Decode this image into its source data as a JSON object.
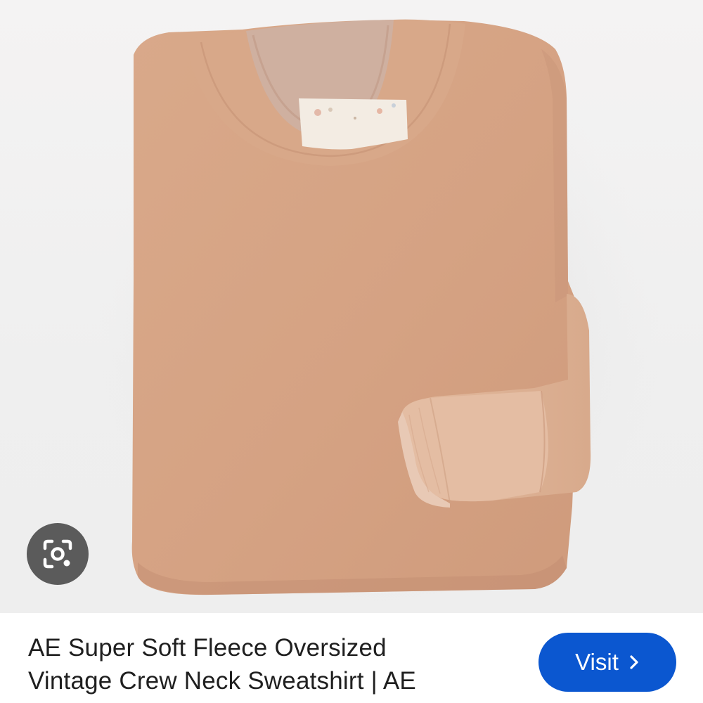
{
  "result": {
    "title_line_1": "AE Super Soft Fleece Oversized",
    "title_line_2": "Vintage Crew Neck Sweatshirt | AE",
    "visit_label": "Visit"
  },
  "image": {
    "garment_color": "#d6a584",
    "background_color": "#f0efef"
  },
  "icons": {
    "lens": "google-lens-icon",
    "chevron": "chevron-right-icon"
  },
  "colors": {
    "accent": "#0b57d0",
    "lens_bg": "#5b5b5b",
    "text": "#1f1f1f"
  }
}
